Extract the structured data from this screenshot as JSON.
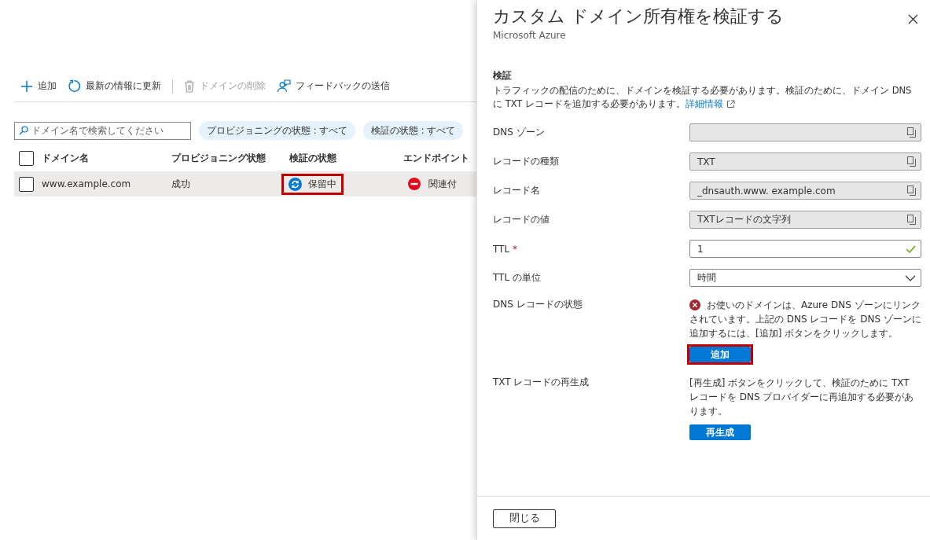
{
  "toolbar": [
    {
      "kind": "add",
      "label": "追加",
      "disabled": false
    },
    {
      "kind": "refresh",
      "label": "最新の情報に更新",
      "disabled": false
    },
    {
      "kind": "delete",
      "label": "ドメインの削除",
      "disabled": true
    },
    {
      "kind": "feedback",
      "label": "フィードバックの送信",
      "disabled": false
    }
  ],
  "search": {
    "placeholder": "ドメイン名で検索してください"
  },
  "filters": [
    "プロビジョニングの状態 : すべて",
    "検証の状態 : すべて"
  ],
  "table": {
    "header_checked": false,
    "columns": [
      "ドメイン名",
      "プロビジョニング状態",
      "検証の状態",
      "エンドポイント"
    ],
    "rows": [
      {
        "checked": false,
        "domain": "www.example.com",
        "provisioning": "成功",
        "validation": "保留中",
        "validation_highlighted": true,
        "endpoint": "関連付"
      }
    ]
  },
  "panel": {
    "title": "カスタム ドメイン所有権を検証する",
    "subtitle": "Microsoft Azure",
    "section": "検証",
    "description": "トラフィックの配信のために、ドメインを検証する必要があります。検証のために、ドメイン DNS に TXT レコードを追加する必要があります。",
    "link": "詳細情報",
    "fields": [
      {
        "kind": "readonly",
        "label": "DNS ゾーン"
      },
      {
        "kind": "readonly",
        "label": "レコードの種類",
        "value": "TXT"
      },
      {
        "kind": "readonly",
        "label": "レコード名",
        "value": "_dnsauth.www. example.com"
      },
      {
        "kind": "readonly",
        "label": "レコードの値",
        "value": "TXTレコードの文字列"
      },
      {
        "kind": "input",
        "label": "TTL",
        "required_mark": "*",
        "valid": true,
        "value": "1"
      },
      {
        "kind": "select",
        "label": "TTL の単位",
        "value": "時間"
      }
    ],
    "actions": [
      {
        "label": "DNS レコードの状態",
        "error": true,
        "text": "お使いのドメインは、Azure DNS ゾーンにリンクされています。上記の DNS レコードを DNS ゾーンに追加するには、[追加] ボタンをクリックします。",
        "button": "追加",
        "highlighted": true
      },
      {
        "label": "TXT レコードの再生成",
        "error": false,
        "text": "[再生成] ボタンをクリックして、検証のために TXT レコードを DNS プロバイダーに再追加する必要があります。",
        "button": "再生成",
        "highlighted": false
      }
    ],
    "close": "閉じる"
  }
}
